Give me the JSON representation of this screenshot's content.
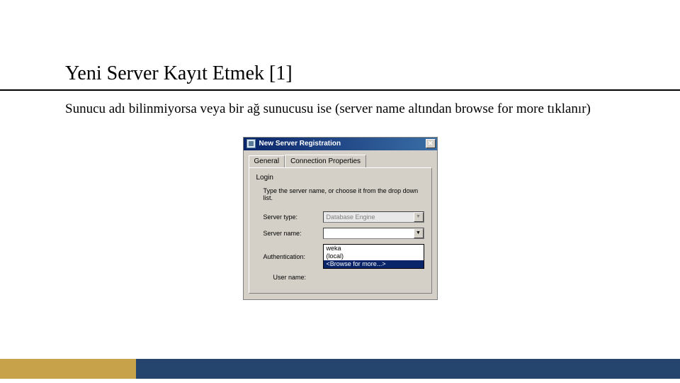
{
  "slide": {
    "title": "Yeni Server Kayıt Etmek [1]",
    "bodyText": "Sunucu adı bilinmiyorsa veya bir ağ sunucusu ise (server name altından browse for more tıklanır)"
  },
  "dialog": {
    "title": "New Server Registration",
    "close": "✕",
    "tabs": {
      "general": "General",
      "connection": "Connection Properties"
    },
    "group": "Login",
    "instruction": "Type the server name, or choose it from the drop down list.",
    "labels": {
      "serverType": "Server type:",
      "serverName": "Server name:",
      "authentication": "Authentication:",
      "userName": "User name:"
    },
    "values": {
      "serverType": "Database Engine",
      "serverName": "",
      "dropdown": {
        "opt1": "weka",
        "opt2": "(local)",
        "opt3": "<Browse for more...>"
      }
    }
  },
  "colors": {
    "footerGold": "#c7a24a",
    "footerNavy": "#26456e"
  }
}
